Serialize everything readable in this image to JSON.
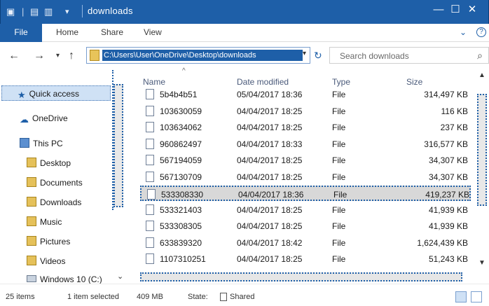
{
  "titlebar": {
    "title": "downloads",
    "quick_access_icons": [
      "save-icon",
      "properties-icon",
      "new-folder-icon",
      "customize-chevron-icon"
    ],
    "minimize": "—",
    "maximize": "☐",
    "close": "✕"
  },
  "ribbon": {
    "file": "File",
    "tabs": [
      "Home",
      "Share",
      "View"
    ],
    "expand": "⌄",
    "help": "?"
  },
  "nav": {
    "back": "←",
    "forward": "→",
    "recent": "▾",
    "up": "↑",
    "address": "C:\\Users\\User\\OneDrive\\Desktop\\downloads",
    "address_dropdown": "▾",
    "refresh": "↻",
    "search_placeholder": "Search downloads",
    "search_icon": "⌕"
  },
  "sidebar": {
    "items": [
      {
        "label": "Quick access",
        "icon": "star-icon"
      },
      {
        "label": "OneDrive",
        "icon": "cloud-icon"
      },
      {
        "label": "This PC",
        "icon": "computer-icon"
      },
      {
        "label": "Desktop",
        "icon": "desktop-folder-icon"
      },
      {
        "label": "Documents",
        "icon": "documents-folder-icon"
      },
      {
        "label": "Downloads",
        "icon": "downloads-folder-icon"
      },
      {
        "label": "Music",
        "icon": "music-folder-icon"
      },
      {
        "label": "Pictures",
        "icon": "pictures-folder-icon"
      },
      {
        "label": "Videos",
        "icon": "videos-folder-icon"
      },
      {
        "label": "Windows 10 (C:)",
        "icon": "drive-icon"
      }
    ],
    "scroll_down": "⌄"
  },
  "columns": {
    "name": "Name",
    "date": "Date modified",
    "type": "Type",
    "size": "Size"
  },
  "files": [
    {
      "name": "5b4b4b51",
      "date": "05/04/2017 18:36",
      "type": "File",
      "size": "314,497 KB"
    },
    {
      "name": "103630059",
      "date": "04/04/2017 18:25",
      "type": "File",
      "size": "116 KB"
    },
    {
      "name": "103634062",
      "date": "04/04/2017 18:25",
      "type": "File",
      "size": "237 KB"
    },
    {
      "name": "960862497",
      "date": "04/04/2017 18:33",
      "type": "File",
      "size": "316,577 KB"
    },
    {
      "name": "567194059",
      "date": "04/04/2017 18:25",
      "type": "File",
      "size": "34,307 KB"
    },
    {
      "name": "567130709",
      "date": "04/04/2017 18:25",
      "type": "File",
      "size": "34,307 KB"
    },
    {
      "name": "533308330",
      "date": "04/04/2017 18:36",
      "type": "File",
      "size": "419,237 KB"
    },
    {
      "name": "533321403",
      "date": "04/04/2017 18:25",
      "type": "File",
      "size": "41,939 KB"
    },
    {
      "name": "533308305",
      "date": "04/04/2017 18:25",
      "type": "File",
      "size": "41,939 KB"
    },
    {
      "name": "633839320",
      "date": "04/04/2017 18:42",
      "type": "File",
      "size": "1,624,439 KB"
    },
    {
      "name": "1107310251",
      "date": "04/04/2017 18:25",
      "type": "File",
      "size": "51,243 KB"
    }
  ],
  "selected_index": 6,
  "status": {
    "items": "25 items",
    "selected": "1 item selected",
    "size": "409 MB",
    "state_label": "State:",
    "state": "Shared"
  },
  "colors": {
    "accent": "#1e5fa8",
    "selection": "#d8d8d8"
  }
}
